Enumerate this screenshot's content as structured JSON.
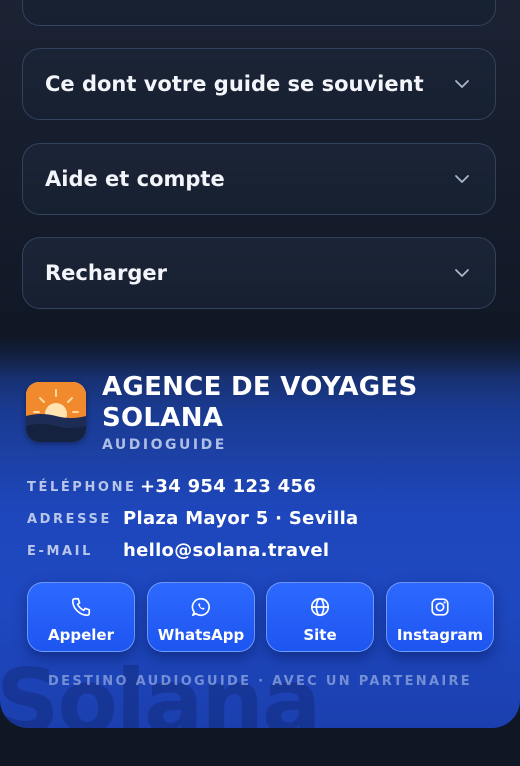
{
  "accordion": {
    "items": [
      {
        "label": "Ce dont votre guide se souvient"
      },
      {
        "label": "Aide et compte"
      },
      {
        "label": "Recharger"
      }
    ]
  },
  "agency": {
    "name_line1": "AGENCE DE VOYAGES",
    "name_line2": "SOLANA",
    "subtitle": "AUDIOGUIDE",
    "watermark": "Solana",
    "logo_icon": "sunset-logo"
  },
  "contact": {
    "phone_label": "TÉLÉPHONE",
    "phone_value": "+34 954 123 456",
    "address_label": "ADRESSE",
    "address_value": "Plaza Mayor 5 · Sevilla",
    "email_label": "E-MAIL",
    "email_value": "hello@solana.travel"
  },
  "actions": {
    "call": {
      "label": "Appeler",
      "icon": "phone-icon"
    },
    "whatsapp": {
      "label": "WhatsApp",
      "icon": "whatsapp-icon"
    },
    "site": {
      "label": "Site",
      "icon": "globe-icon"
    },
    "instagram": {
      "label": "Instagram",
      "icon": "instagram-icon"
    }
  },
  "footer": {
    "note": "DESTINO AUDIOGUIDE · AVEC UN PARTENAIRE"
  },
  "colors": {
    "background": "#0f1624",
    "card_blue": "#1e47bd",
    "button_blue": "#2d69ff",
    "logo_orange": "#f08a2c",
    "logo_navy": "#1c2c55"
  }
}
